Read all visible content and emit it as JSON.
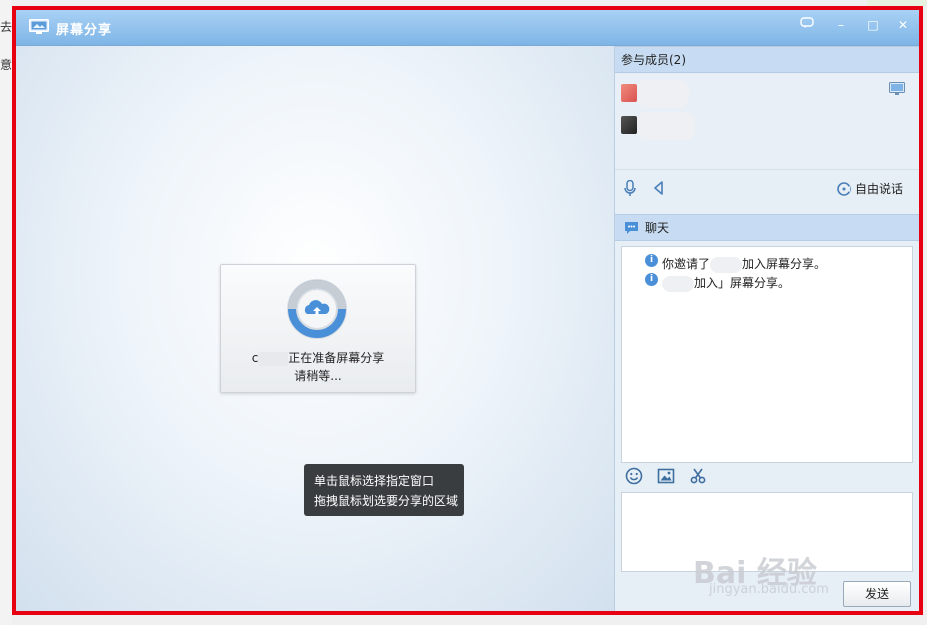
{
  "background_app": {
    "line1": "去小",
    "line2": "意事"
  },
  "window": {
    "title": "屏幕分享",
    "buttons": {
      "feedback": "feedback-icon",
      "minimize": "–",
      "maximize": "□",
      "close": "✕"
    }
  },
  "share_area": {
    "status_line1_suffix": "正在准备屏幕分享",
    "status_line1_prefix": "c",
    "status_line2": "请稍等...",
    "tooltip_line1": "单击鼠标选择指定窗口",
    "tooltip_line2": "拖拽鼠标划选要分享的区域"
  },
  "members": {
    "header": "参与成员(2)"
  },
  "audio": {
    "free_talk_label": "自由说话"
  },
  "chat": {
    "header": "聊天",
    "messages": {
      "m1_before": "你邀请了",
      "m1_after": "加入屏幕分享。",
      "m2_after": "加入」屏幕分享。"
    },
    "send_label": "发送"
  },
  "watermark": {
    "brand": "Bai 经验",
    "url": "jingyan.baidu.com"
  },
  "colors": {
    "title_gradient_top": "#a9d1f5",
    "title_gradient_bottom": "#7eb5e6",
    "highlight_border": "#e60012",
    "section_header": "#c7dcf2",
    "accent_icon": "#4a90d9"
  }
}
